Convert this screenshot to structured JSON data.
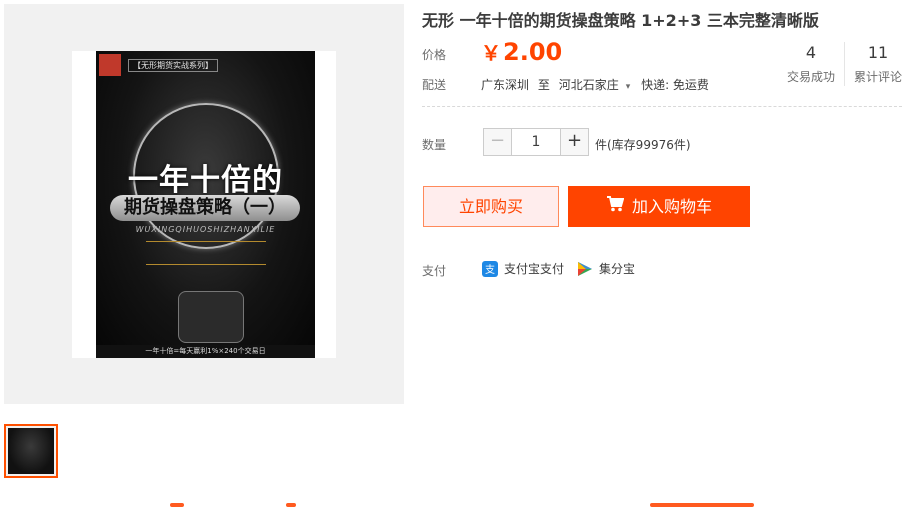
{
  "product": {
    "title": "无形 一年十倍的期货操盘策略 1+2+3 三本完整清晰版",
    "cover": {
      "series": "【无形期货实战系列】",
      "main_title": "一年十倍的",
      "subtitle": "期货操盘策略（一）",
      "pinyin": "WUXINGQIHUOSHIZHANXILIE",
      "bottom_text": "一年十倍=每天赢利1%×240个交易日"
    }
  },
  "price": {
    "label": "价格",
    "currency": "￥",
    "amount": "2.00"
  },
  "shipping": {
    "label": "配送",
    "from": "广东深圳",
    "to_word": "至",
    "to": "河北石家庄",
    "caret": "▾",
    "method": "快递: 免运费"
  },
  "stats": {
    "sales": {
      "count": "4",
      "caption": "交易成功"
    },
    "reviews": {
      "count": "11",
      "caption": "累计评论"
    }
  },
  "quantity": {
    "label": "数量",
    "minus": "−",
    "plus": "+",
    "value": "1",
    "stock": "件(库存99976件)"
  },
  "actions": {
    "buy_now": "立即购买",
    "add_to_cart": "加入购物车"
  },
  "payment": {
    "label": "支付",
    "methods": [
      {
        "name": "支付宝支付",
        "icon": "alipay-icon",
        "color": "#1e88e5"
      },
      {
        "name": "集分宝",
        "icon": "jifenbao-icon",
        "color": "#34a853"
      }
    ]
  },
  "colors": {
    "accent": "#ff4400",
    "buy_bg": "#ffeded",
    "thumb_border": "#ff5000"
  }
}
